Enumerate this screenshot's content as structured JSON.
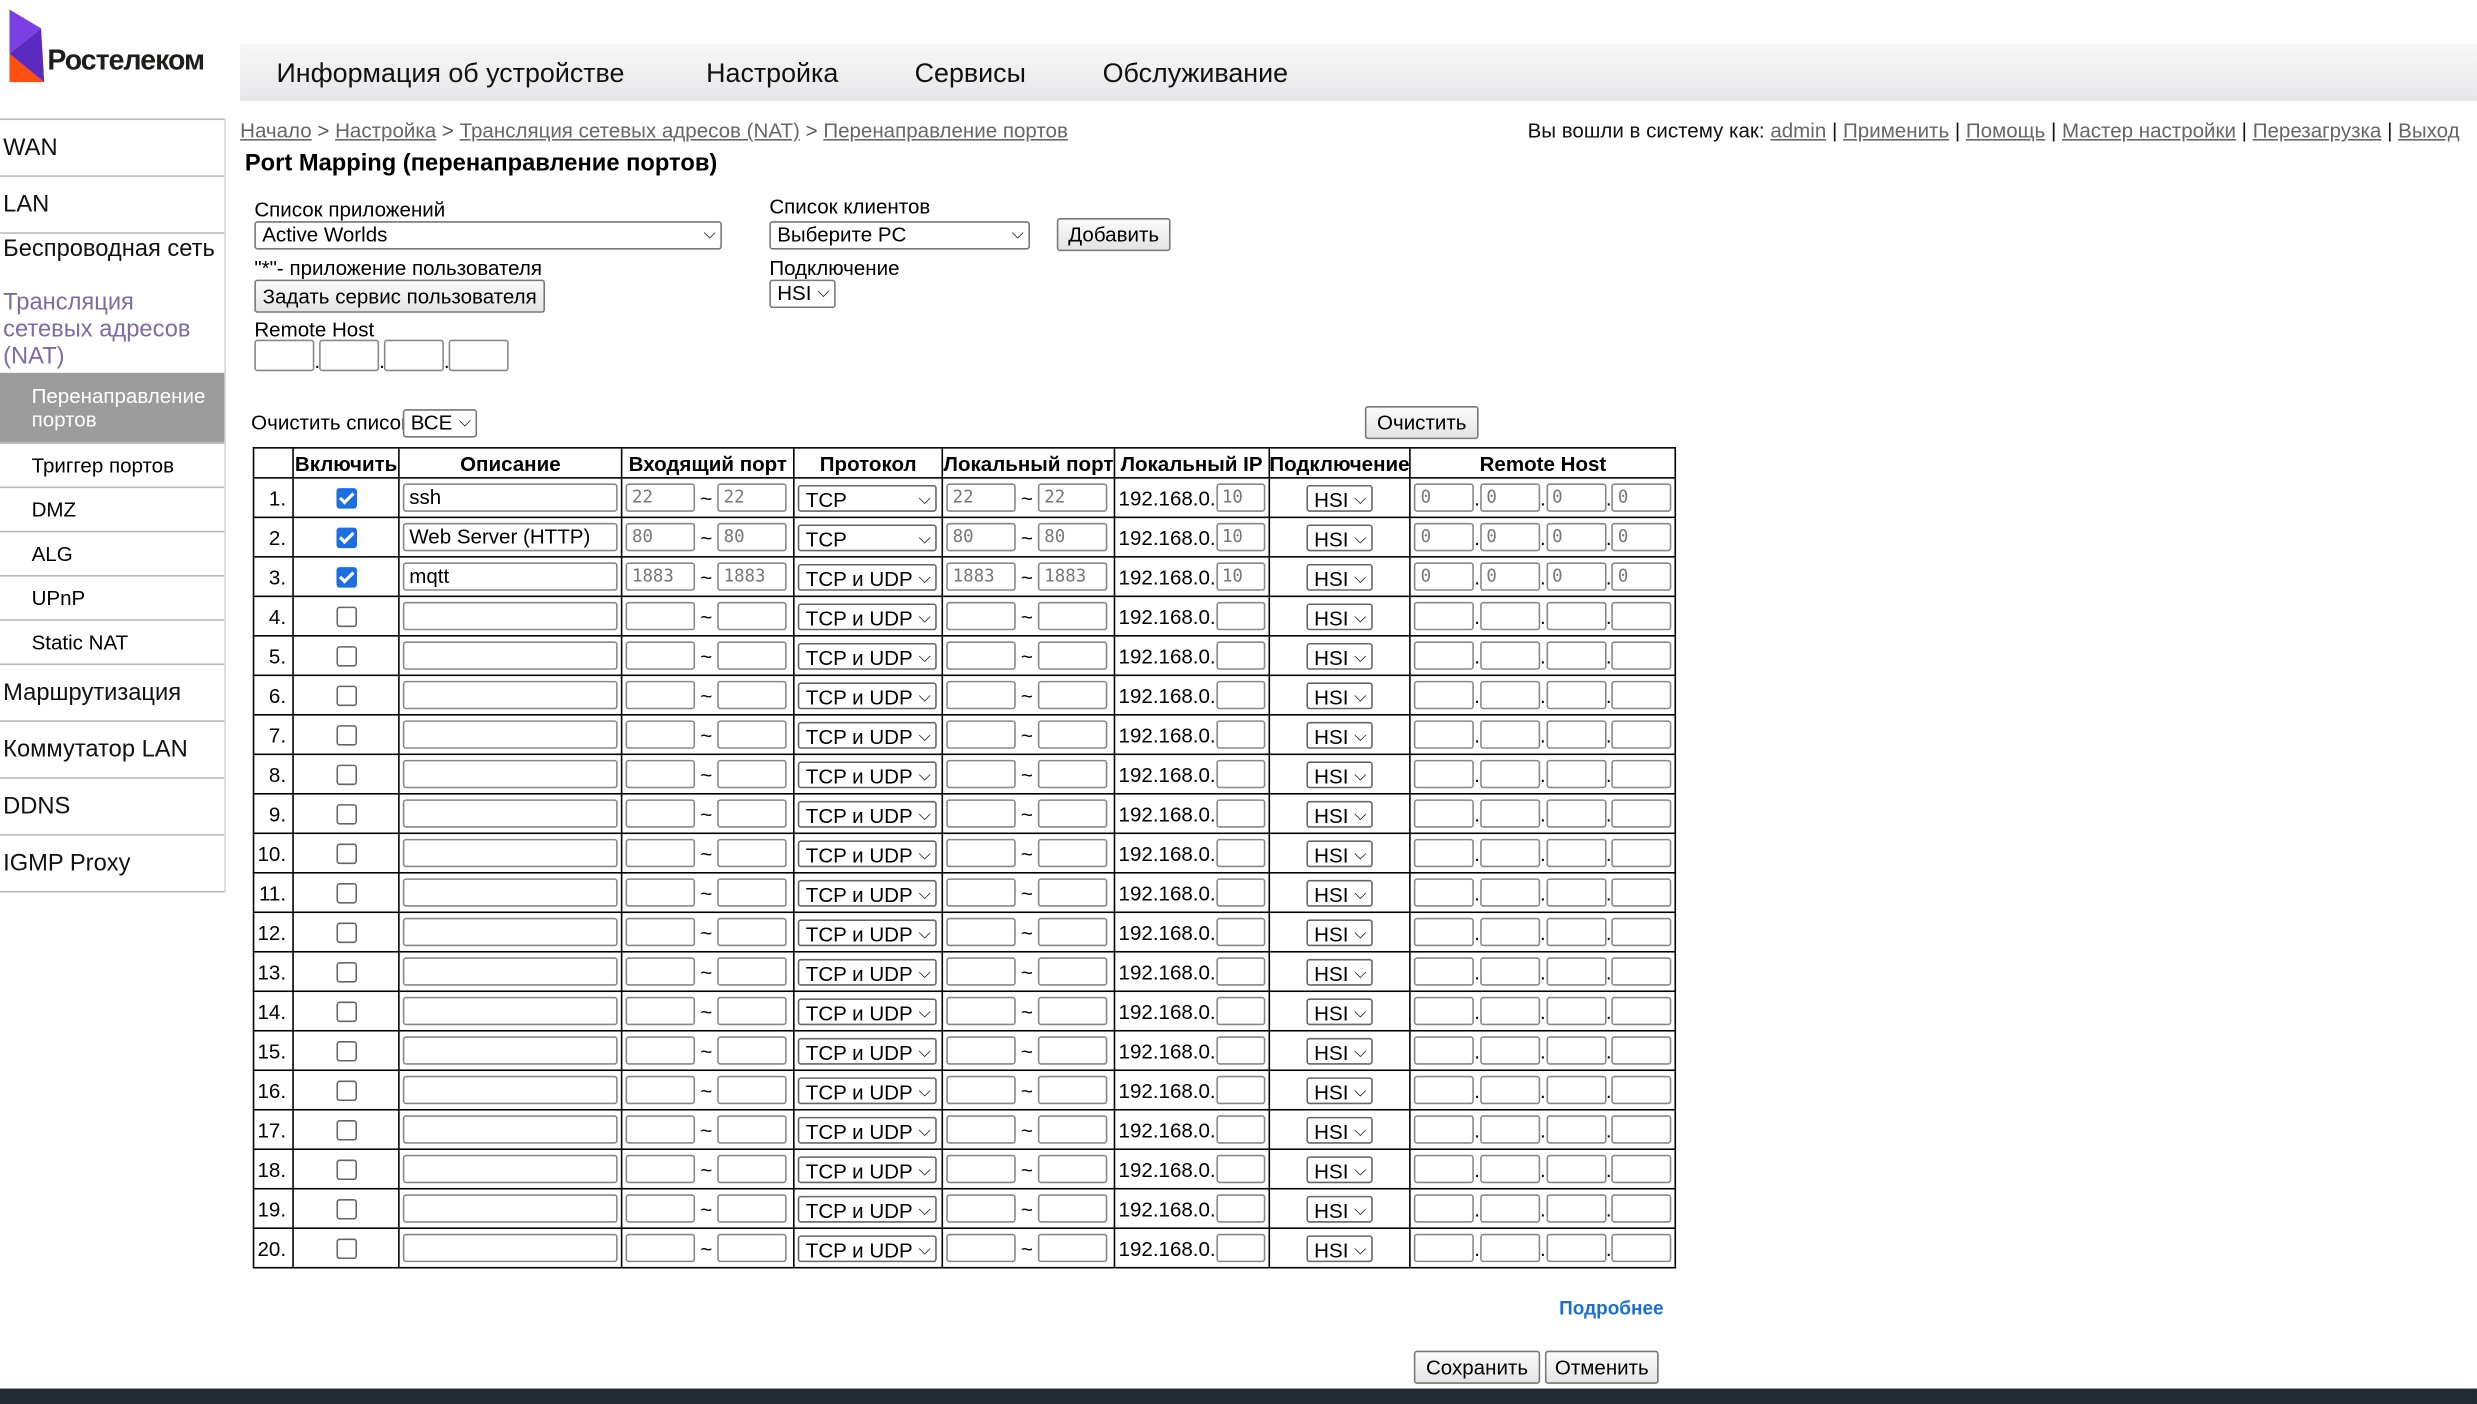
{
  "brand": {
    "name": "Ростелеком",
    "color": "#7b3fe4",
    "accent": "#ff4f12"
  },
  "topnav": [
    "Информация об устройстве",
    "Настройка",
    "Сервисы",
    "Обслуживание"
  ],
  "sidebar": {
    "items_top": [
      "WAN",
      "LAN"
    ],
    "wireless": "Беспроводная сеть",
    "nat": "Трансляция сетевых адресов (NAT)",
    "nat_sub": [
      "Перенаправление портов",
      "Триггер портов",
      "DMZ",
      "ALG",
      "UPnP",
      "Static NAT"
    ],
    "items_bottom": [
      "Маршрутизация",
      "Коммутатор LAN",
      "DDNS",
      "IGMP Proxy"
    ]
  },
  "breadcrumb": [
    "Начало",
    "Настройка",
    "Трансляция сетевых адресов (NAT)",
    "Перенаправление портов"
  ],
  "userbar": {
    "prefix": "Вы вошли в систему как:",
    "user": "admin",
    "links": [
      "Применить",
      "Помощь",
      "Мастер настройки",
      "Перезагрузка",
      "Выход"
    ]
  },
  "title": "Port Mapping (перенаправление портов)",
  "form": {
    "app_list_label": "Список приложений",
    "app_list_value": "Active Worlds",
    "user_app_note": "\"*\"- приложение пользователя",
    "custom_service_btn": "Задать сервис пользователя",
    "remote_host_label": "Remote Host",
    "clients_label": "Список клиентов",
    "clients_value": "Выберите PC",
    "add_btn": "Добавить",
    "connection_label": "Подключение",
    "connection_value": "HSI",
    "clear_list_label": "Очистить список",
    "clear_list_value": "ВСЕ",
    "clear_btn": "Очистить"
  },
  "table": {
    "headers": [
      "",
      "Включить",
      "Описание",
      "Входящий порт",
      "Протокол",
      "Локальный порт",
      "Локальный IP",
      "Подключение",
      "Remote Host"
    ],
    "ip_prefix": "192.168.0.",
    "rows": [
      {
        "n": "1.",
        "on": true,
        "desc": "ssh",
        "in_a": "22",
        "in_b": "22",
        "proto": "TCP",
        "loc_a": "22",
        "loc_b": "22",
        "ip": "10",
        "conn": "HSI",
        "rh": [
          "0",
          "0",
          "0",
          "0"
        ]
      },
      {
        "n": "2.",
        "on": true,
        "desc": "Web Server (HTTP)",
        "in_a": "80",
        "in_b": "80",
        "proto": "TCP",
        "loc_a": "80",
        "loc_b": "80",
        "ip": "10",
        "conn": "HSI",
        "rh": [
          "0",
          "0",
          "0",
          "0"
        ]
      },
      {
        "n": "3.",
        "on": true,
        "desc": "mqtt",
        "in_a": "1883",
        "in_b": "1883",
        "proto": "TCP и UDP",
        "loc_a": "1883",
        "loc_b": "1883",
        "ip": "10",
        "conn": "HSI",
        "rh": [
          "0",
          "0",
          "0",
          "0"
        ]
      },
      {
        "n": "4.",
        "on": false,
        "desc": "",
        "in_a": "",
        "in_b": "",
        "proto": "TCP и UDP",
        "loc_a": "",
        "loc_b": "",
        "ip": "",
        "conn": "HSI",
        "rh": [
          "",
          "",
          "",
          ""
        ]
      },
      {
        "n": "5.",
        "on": false,
        "desc": "",
        "in_a": "",
        "in_b": "",
        "proto": "TCP и UDP",
        "loc_a": "",
        "loc_b": "",
        "ip": "",
        "conn": "HSI",
        "rh": [
          "",
          "",
          "",
          ""
        ]
      },
      {
        "n": "6.",
        "on": false,
        "desc": "",
        "in_a": "",
        "in_b": "",
        "proto": "TCP и UDP",
        "loc_a": "",
        "loc_b": "",
        "ip": "",
        "conn": "HSI",
        "rh": [
          "",
          "",
          "",
          ""
        ]
      },
      {
        "n": "7.",
        "on": false,
        "desc": "",
        "in_a": "",
        "in_b": "",
        "proto": "TCP и UDP",
        "loc_a": "",
        "loc_b": "",
        "ip": "",
        "conn": "HSI",
        "rh": [
          "",
          "",
          "",
          ""
        ]
      },
      {
        "n": "8.",
        "on": false,
        "desc": "",
        "in_a": "",
        "in_b": "",
        "proto": "TCP и UDP",
        "loc_a": "",
        "loc_b": "",
        "ip": "",
        "conn": "HSI",
        "rh": [
          "",
          "",
          "",
          ""
        ]
      },
      {
        "n": "9.",
        "on": false,
        "desc": "",
        "in_a": "",
        "in_b": "",
        "proto": "TCP и UDP",
        "loc_a": "",
        "loc_b": "",
        "ip": "",
        "conn": "HSI",
        "rh": [
          "",
          "",
          "",
          ""
        ]
      },
      {
        "n": "10.",
        "on": false,
        "desc": "",
        "in_a": "",
        "in_b": "",
        "proto": "TCP и UDP",
        "loc_a": "",
        "loc_b": "",
        "ip": "",
        "conn": "HSI",
        "rh": [
          "",
          "",
          "",
          ""
        ]
      },
      {
        "n": "11.",
        "on": false,
        "desc": "",
        "in_a": "",
        "in_b": "",
        "proto": "TCP и UDP",
        "loc_a": "",
        "loc_b": "",
        "ip": "",
        "conn": "HSI",
        "rh": [
          "",
          "",
          "",
          ""
        ]
      },
      {
        "n": "12.",
        "on": false,
        "desc": "",
        "in_a": "",
        "in_b": "",
        "proto": "TCP и UDP",
        "loc_a": "",
        "loc_b": "",
        "ip": "",
        "conn": "HSI",
        "rh": [
          "",
          "",
          "",
          ""
        ]
      },
      {
        "n": "13.",
        "on": false,
        "desc": "",
        "in_a": "",
        "in_b": "",
        "proto": "TCP и UDP",
        "loc_a": "",
        "loc_b": "",
        "ip": "",
        "conn": "HSI",
        "rh": [
          "",
          "",
          "",
          ""
        ]
      },
      {
        "n": "14.",
        "on": false,
        "desc": "",
        "in_a": "",
        "in_b": "",
        "proto": "TCP и UDP",
        "loc_a": "",
        "loc_b": "",
        "ip": "",
        "conn": "HSI",
        "rh": [
          "",
          "",
          "",
          ""
        ]
      },
      {
        "n": "15.",
        "on": false,
        "desc": "",
        "in_a": "",
        "in_b": "",
        "proto": "TCP и UDP",
        "loc_a": "",
        "loc_b": "",
        "ip": "",
        "conn": "HSI",
        "rh": [
          "",
          "",
          "",
          ""
        ]
      },
      {
        "n": "16.",
        "on": false,
        "desc": "",
        "in_a": "",
        "in_b": "",
        "proto": "TCP и UDP",
        "loc_a": "",
        "loc_b": "",
        "ip": "",
        "conn": "HSI",
        "rh": [
          "",
          "",
          "",
          ""
        ]
      },
      {
        "n": "17.",
        "on": false,
        "desc": "",
        "in_a": "",
        "in_b": "",
        "proto": "TCP и UDP",
        "loc_a": "",
        "loc_b": "",
        "ip": "",
        "conn": "HSI",
        "rh": [
          "",
          "",
          "",
          ""
        ]
      },
      {
        "n": "18.",
        "on": false,
        "desc": "",
        "in_a": "",
        "in_b": "",
        "proto": "TCP и UDP",
        "loc_a": "",
        "loc_b": "",
        "ip": "",
        "conn": "HSI",
        "rh": [
          "",
          "",
          "",
          ""
        ]
      },
      {
        "n": "19.",
        "on": false,
        "desc": "",
        "in_a": "",
        "in_b": "",
        "proto": "TCP и UDP",
        "loc_a": "",
        "loc_b": "",
        "ip": "",
        "conn": "HSI",
        "rh": [
          "",
          "",
          "",
          ""
        ]
      },
      {
        "n": "20.",
        "on": false,
        "desc": "",
        "in_a": "",
        "in_b": "",
        "proto": "TCP и UDP",
        "loc_a": "",
        "loc_b": "",
        "ip": "",
        "conn": "HSI",
        "rh": [
          "",
          "",
          "",
          ""
        ]
      }
    ]
  },
  "more_link": "Подробнее",
  "save_btn": "Сохранить",
  "cancel_btn": "Отменить"
}
